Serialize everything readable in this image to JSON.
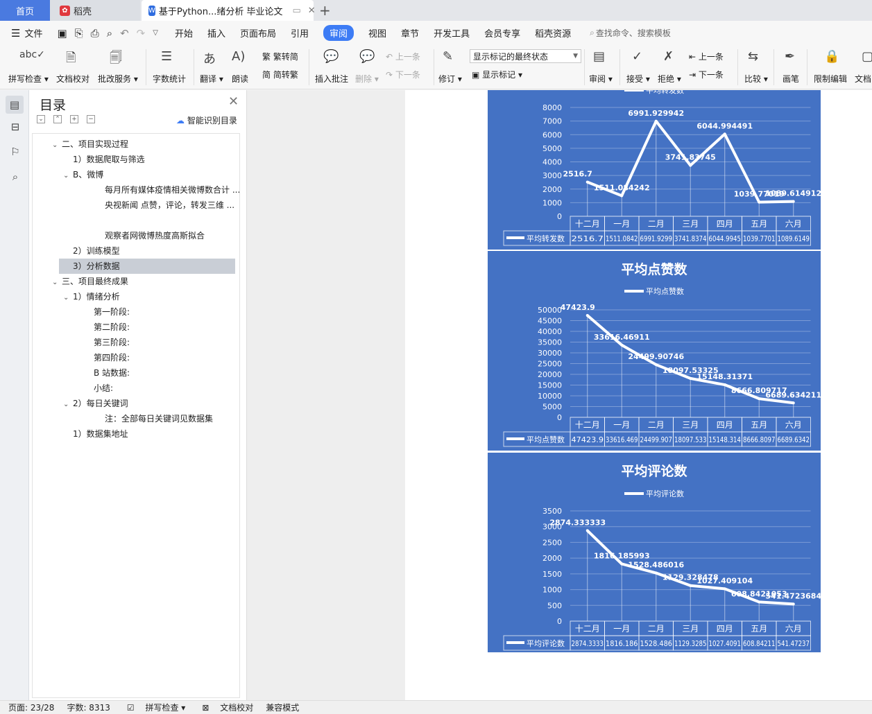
{
  "tabs": {
    "home": "首页",
    "daoke": "稻壳",
    "doc": "基于Python...绪分析 毕业论文"
  },
  "menu": {
    "file": "文件",
    "items": [
      "开始",
      "插入",
      "页面布局",
      "引用",
      "审阅",
      "视图",
      "章节",
      "开发工具",
      "会员专享",
      "稻壳资源"
    ],
    "search": "查找命令、搜索模板"
  },
  "ribbon": {
    "spell": "拼写检查",
    "proof": "文档校对",
    "approve": "批改服务",
    "wordcount": "字数统计",
    "translate": "翻译",
    "read": "朗读",
    "trad": "繁转简",
    "simp": "简转繁",
    "comment": "插入批注",
    "delete": "删除",
    "prev": "上一条",
    "next": "下一条",
    "revise": "修订",
    "state": "显示标记的最终状态",
    "show_marks": "显示标记",
    "review": "审阅",
    "accept": "接受",
    "reject": "拒绝",
    "prev2": "上一条",
    "next2": "下一条",
    "compare": "比较",
    "pen": "画笔",
    "restrict": "限制编辑",
    "doc": "文档"
  },
  "toc": {
    "title": "目录",
    "smart": "智能识别目录",
    "items": [
      {
        "t": "二、项目实现过程",
        "l": 1,
        "a": "v"
      },
      {
        "t": "1）数据爬取与筛选",
        "l": 2,
        "a": ""
      },
      {
        "t": "B、微博",
        "l": 2,
        "a": "v"
      },
      {
        "t": "每月所有媒体疫情相关微博数合计 ...",
        "l": 4,
        "a": ""
      },
      {
        "t": "央视新闻 点赞，评论，转发三维 ...",
        "l": 4,
        "a": ""
      },
      {
        "t": "",
        "l": 4,
        "a": ""
      },
      {
        "t": "观察者网微博热度高斯拟合",
        "l": 4,
        "a": ""
      },
      {
        "t": "2）训练模型",
        "l": 2,
        "a": ""
      },
      {
        "t": "3）分析数据",
        "l": 2,
        "a": "",
        "sel": true
      },
      {
        "t": "三、项目最终成果",
        "l": 1,
        "a": "v"
      },
      {
        "t": "1）情绪分析",
        "l": 2,
        "a": "v"
      },
      {
        "t": "第一阶段:",
        "l": 3,
        "a": ""
      },
      {
        "t": "第二阶段:",
        "l": 3,
        "a": ""
      },
      {
        "t": "第三阶段:",
        "l": 3,
        "a": ""
      },
      {
        "t": "第四阶段:",
        "l": 3,
        "a": ""
      },
      {
        "t": "B 站数据:",
        "l": 3,
        "a": ""
      },
      {
        "t": "小结:",
        "l": 3,
        "a": ""
      },
      {
        "t": "2）每日关键词",
        "l": 2,
        "a": "v"
      },
      {
        "t": "注：全部每日关键词见数据集",
        "l": 4,
        "a": ""
      },
      {
        "t": "1）数据集地址",
        "l": 2,
        "a": ""
      }
    ]
  },
  "status": {
    "page": "页面: 23/28",
    "words": "字数: 8313",
    "spell": "拼写检查",
    "proof": "文档校对",
    "compat": "兼容模式"
  },
  "colors": {
    "chart_bg": "#4472c4",
    "accent": "#3d7cf5"
  },
  "chart_data": [
    {
      "type": "line",
      "title": "",
      "legend": "平均转发数",
      "categories": [
        "十二月",
        "一月",
        "二月",
        "三月",
        "四月",
        "五月",
        "六月"
      ],
      "values": [
        2516.7,
        1511.084242,
        6991.929942,
        3741.83745,
        6044.994491,
        1039.770193,
        1089.614912
      ],
      "labels": [
        "2516.7",
        "1511.084242",
        "6991.929942",
        "3741.83745",
        "6044.994491",
        "1039.77019",
        "1089.614912"
      ],
      "table": [
        "2516.7",
        "1511.0842",
        "6991.9299",
        "3741.8374",
        "6044.9945",
        "1039.7701",
        "1089.6149"
      ],
      "yticks": [
        "0",
        "1000",
        "2000",
        "3000",
        "4000",
        "5000",
        "6000",
        "7000",
        "8000"
      ],
      "ymax": 8000
    },
    {
      "type": "line",
      "title": "平均点赞数",
      "legend": "平均点赞数",
      "categories": [
        "十二月",
        "一月",
        "二月",
        "三月",
        "四月",
        "五月",
        "六月"
      ],
      "values": [
        47423.9,
        33616.46911,
        24499.90746,
        18097.53325,
        15148.31371,
        8666.809717,
        6689.634211
      ],
      "labels": [
        "47423.9",
        "33616.46911",
        "24499.90746",
        "18097.53325",
        "15148.31371",
        "8666.809717",
        "6689.634211"
      ],
      "table": [
        "47423.9",
        "33616.469",
        "24499.907",
        "18097.533",
        "15148.314",
        "8666.8097",
        "6689.6342"
      ],
      "yticks": [
        "0",
        "5000",
        "10000",
        "15000",
        "20000",
        "25000",
        "30000",
        "35000",
        "40000",
        "45000",
        "50000"
      ],
      "ymax": 50000
    },
    {
      "type": "line",
      "title": "平均评论数",
      "legend": "平均评论数",
      "categories": [
        "十二月",
        "一月",
        "二月",
        "三月",
        "四月",
        "五月",
        "六月"
      ],
      "values": [
        2874.333333,
        1816.185993,
        1528.486016,
        1129.328478,
        1027.409104,
        608.8421053,
        541.4723684
      ],
      "labels": [
        "2874.333333",
        "1816.185993",
        "1528.486016",
        "1129.328478",
        "1027.409104",
        "608.8421053",
        "541.4723684"
      ],
      "table": [
        "2874.3333",
        "1816.186",
        "1528.486",
        "1129.3285",
        "1027.4091",
        "608.84211",
        "541.47237"
      ],
      "yticks": [
        "0",
        "500",
        "1000",
        "1500",
        "2000",
        "2500",
        "3000",
        "3500"
      ],
      "ymax": 3500
    }
  ]
}
